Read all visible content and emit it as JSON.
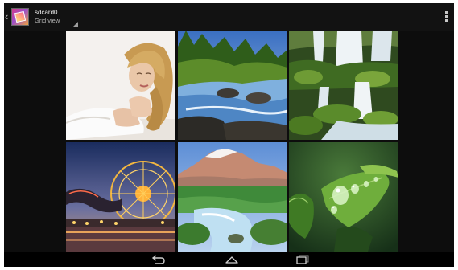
{
  "action_bar": {
    "album_title": "sdcard0",
    "view_mode": "Grid view",
    "icons": {
      "up": "up-caret-icon",
      "album": "album-thumbnail",
      "dropdown": "dropdown-corner-icon",
      "overflow": "overflow-menu-icon"
    }
  },
  "grid": {
    "columns": 3,
    "rows": 2,
    "photos": [
      {
        "subject": "woman-portrait"
      },
      {
        "subject": "forest-river"
      },
      {
        "subject": "mossy-waterfall"
      },
      {
        "subject": "ferris-wheel-night"
      },
      {
        "subject": "snowy-mountain-stream"
      },
      {
        "subject": "green-leaf-dewdrops"
      }
    ]
  },
  "nav_bar": {
    "buttons": [
      "back-icon",
      "home-icon",
      "recent-apps-icon"
    ]
  },
  "colors": {
    "background": "#0d0d0d",
    "action_bar": "#121212",
    "nav_bar": "#000000",
    "primary_text": "#f2f2f2",
    "secondary_text": "#b5b5b5"
  }
}
